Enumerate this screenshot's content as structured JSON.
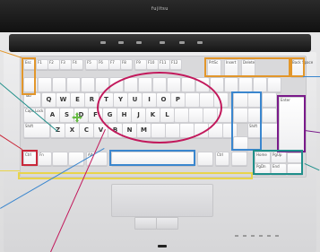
{
  "laptop": {
    "brand": "fujitsu"
  },
  "callout_colors": {
    "orange": "#e2962a",
    "blue": "#3a86ce",
    "teal": "#1f8f8a",
    "red": "#c9283a",
    "purple": "#7a1a8a",
    "yellow": "#e8d44c",
    "magenta": "#c2185b",
    "green": "#66bb44"
  },
  "icons": {
    "move": "four-way-arrow-icon"
  },
  "keys": {
    "esc": "Esc",
    "f1": "F1",
    "f2": "F2",
    "f3": "F3",
    "f4": "F4",
    "f5": "F5",
    "f6": "F6",
    "f7": "F7",
    "f8": "F8",
    "f9": "F9",
    "f10": "F10",
    "f11": "F11",
    "f12": "F12",
    "prtsc": "PrtSc",
    "insert": "Insert",
    "delete": "Delete",
    "backspace": "Back Space",
    "tab": "Tab",
    "q": "Q",
    "w": "W",
    "e": "E",
    "r": "R",
    "t": "T",
    "y": "Y",
    "u": "U",
    "i": "I",
    "o": "O",
    "p": "P",
    "enter": "Enter",
    "capslock": "Caps Lock",
    "a": "A",
    "s": "S",
    "d": "D",
    "f": "F",
    "g": "G",
    "h": "H",
    "j": "J",
    "k": "K",
    "l": "L",
    "shift_left": "Shift",
    "z": "Z",
    "x": "X",
    "c": "C",
    "v": "V",
    "b": "B",
    "n": "N",
    "m": "M",
    "shift_right": "Shift",
    "ctrl_left": "Ctrl",
    "fn": "Fn",
    "alt": "Alt",
    "space": "",
    "ctrl_right": "Ctrl",
    "home": "Home",
    "pgup": "PgUp",
    "pgdn": "PgDn",
    "end": "End"
  }
}
